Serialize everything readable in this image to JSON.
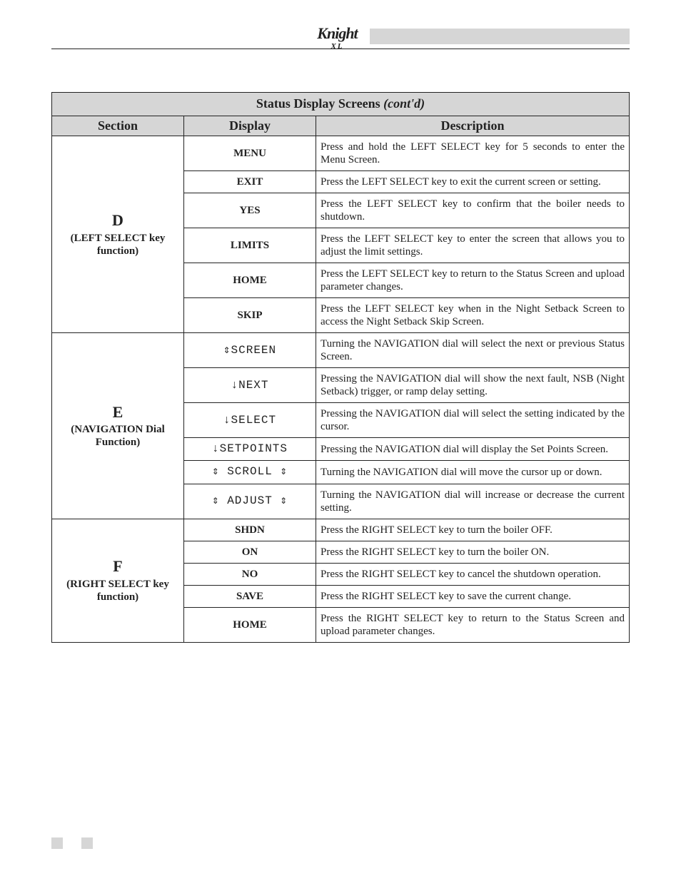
{
  "logo": {
    "brand": "Knight",
    "suffix": "XL"
  },
  "table": {
    "title": "Status Display Screens",
    "title_suffix": "(cont'd)",
    "columns": {
      "section": "Section",
      "display": "Display",
      "description": "Description"
    },
    "sections": [
      {
        "letter": "D",
        "label": "(LEFT SELECT key function)",
        "rows": [
          {
            "display": "MENU",
            "lcd": false,
            "description": "Press and hold the LEFT SELECT key for 5 seconds to enter the Menu Screen."
          },
          {
            "display": "EXIT",
            "lcd": false,
            "description": "Press the LEFT SELECT key to exit the current screen or setting."
          },
          {
            "display": "YES",
            "lcd": false,
            "description": "Press the LEFT SELECT key to confirm that the boiler needs to shutdown."
          },
          {
            "display": "LIMITS",
            "lcd": false,
            "description": "Press the LEFT SELECT key to enter the screen that allows you to adjust the limit settings."
          },
          {
            "display": "HOME",
            "lcd": false,
            "description": "Press the LEFT SELECT key to return to the Status Screen and upload parameter changes."
          },
          {
            "display": "SKIP",
            "lcd": false,
            "description": "Press the LEFT SELECT key when in the Night Setback Screen to access the Night Setback Skip Screen."
          }
        ]
      },
      {
        "letter": "E",
        "label": "(NAVIGATION Dial Function)",
        "rows": [
          {
            "display": "⇕SCREEN",
            "lcd": true,
            "description": "Turning the NAVIGATION dial will select the next or previous Status Screen."
          },
          {
            "display": "↓NEXT",
            "lcd": true,
            "description": "Pressing the NAVIGATION dial will show the next fault, NSB (Night Setback) trigger, or ramp delay setting."
          },
          {
            "display": "↓SELECT",
            "lcd": true,
            "description": "Pressing the NAVIGATION dial will select the setting indicated by the cursor."
          },
          {
            "display": "↓SETPOINTS",
            "lcd": true,
            "description": "Pressing the NAVIGATION dial will display the Set Points Screen."
          },
          {
            "display": "⇕ SCROLL ⇕",
            "lcd": true,
            "description": "Turning the NAVIGATION dial will move the cursor up or down."
          },
          {
            "display": "⇕ ADJUST ⇕",
            "lcd": true,
            "description": "Turning the NAVIGATION dial will increase or decrease the current setting."
          }
        ]
      },
      {
        "letter": "F",
        "label": "(RIGHT SELECT key function)",
        "rows": [
          {
            "display": "SHDN",
            "lcd": false,
            "description": "Press the RIGHT SELECT key to turn the boiler OFF."
          },
          {
            "display": "ON",
            "lcd": false,
            "description": "Press the RIGHT SELECT key to turn the boiler ON."
          },
          {
            "display": "NO",
            "lcd": false,
            "description": "Press the RIGHT SELECT key to cancel the shutdown operation."
          },
          {
            "display": "SAVE",
            "lcd": false,
            "description": "Press the RIGHT SELECT key to save the current change."
          },
          {
            "display": "HOME",
            "lcd": false,
            "description": "Press the RIGHT SELECT key to return to the Status Screen and upload parameter changes."
          }
        ]
      }
    ]
  }
}
